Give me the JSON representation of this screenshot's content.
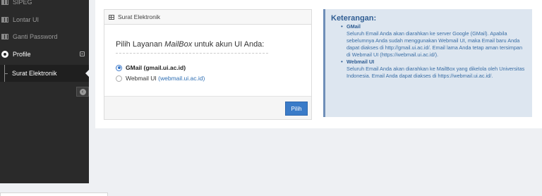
{
  "sidebar": {
    "items": [
      {
        "label": "SIPEG",
        "icon": "grid-icon"
      },
      {
        "label": "Lontar UI",
        "icon": "grid-icon"
      },
      {
        "label": "Ganti Password",
        "icon": "grid-icon"
      }
    ],
    "profile_label": "Profile",
    "sub_item_label": "Surat Elektronik"
  },
  "widget": {
    "title": "Surat Elektronik",
    "prompt_before": "Pilih Layanan ",
    "prompt_em": "MailBox",
    "prompt_after": " untuk akun UI Anda:",
    "options": [
      {
        "name": "GMail",
        "link": "(gmail.ui.ac.id)",
        "selected": true
      },
      {
        "name": "Webmail UI",
        "link": "(webmail.ui.ac.id)",
        "selected": false
      }
    ],
    "submit_label": "Pilih"
  },
  "info": {
    "heading": "Keterangan:",
    "items": [
      {
        "title": "GMail",
        "text": "Seluruh Email Anda akan diarahkan ke server Google (GMail). Apabila sebelumnya Anda sudah menggunakan Webmail UI, maka Email baru Anda dapat diakses di http://gmail.ui.ac.id/. Email lama Anda tetap aman tersimpan di Webmail UI (https://webmail.ui.ac.id/)."
      },
      {
        "title": "Webmail UI",
        "text": "Seluruh Email Anda akan diarahkan ke MailBox yang dikelola oleh Universitas Indonesia. Email Anda dapat diakses di https://webmail.ui.ac.id/."
      }
    ]
  },
  "colors": {
    "sidebar_bg": "#2a2a2a",
    "accent": "#3a7bc8",
    "info_bg": "#dde6f0",
    "info_title": "#2f5d93"
  }
}
